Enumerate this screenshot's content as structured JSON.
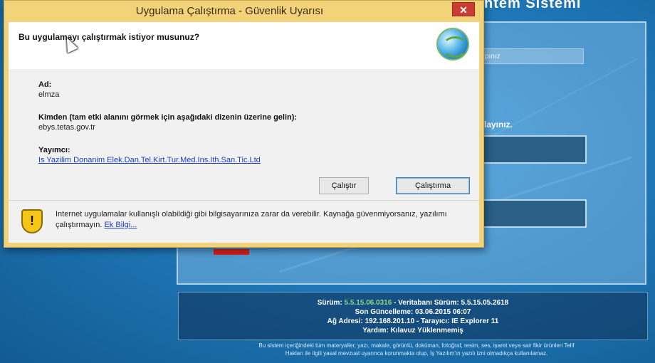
{
  "background": {
    "app_title": "ntem Sistemi",
    "login_hint": "pınız",
    "login_instruction": "layınız.",
    "info_line1_label": "Sürüm: ",
    "info_line1_version": "5.5.15.06.0316",
    "info_line1_rest": " - Veritabanı Sürüm: 5.5.15.05.2618",
    "info_line2": "Son Güncelleme: 03.06.2015 06:07",
    "info_line3": "Ağ Adresi: 192.168.201.10 - Tarayıcı: IE Explorer 11",
    "info_line4": "Yardım: Kılavuz Yüklenmemiş",
    "footer_line1": "Bu sistem içeriğindeki tüm materyaller, yazı, makale, görüntü, doküman, fotoğraf, resim, ses, işaret veya sair fikir ürünleri Telif",
    "footer_line2": "Hakları ile ilgili yasal mevzuat uyarınca korunmakta olup, İş Yazılım'ın yazılı izni olmadıkça kullanılamaz."
  },
  "dialog": {
    "title": "Uygulama Çalıştırma - Güvenlik Uyarısı",
    "close_glyph": "✕",
    "question": "Bu uygulamayı çalıştırmak istiyor musunuz?",
    "name_label": "Ad:",
    "name_value": "elmza",
    "from_label": "Kimden (tam etki alanını görmek için aşağıdaki dizenin üzerine gelin):",
    "from_value": "ebys.tetas.gov.tr",
    "publisher_label": "Yayımcı:",
    "publisher_value": "Is Yazilim Donanim Elek.Dan.Tel.Kirt.Tur.Med.Ins.Ith.San.Tic.Ltd",
    "run_button": "Çalıştır",
    "dont_run_button": "Çalıştırma",
    "warning_text": "Internet uygulamalar kullanışlı olabildiği gibi bilgisayarınıza zarar da verebilir. Kaynağa güvenmiyorsanız, yazılımı çalıştırmayın.",
    "more_info_link": "Ek Bilgi...",
    "shield_glyph": "!"
  },
  "icons": {
    "globe": "globe-icon",
    "shield": "shield-warning-icon",
    "cursor": "cursor-icon"
  },
  "colors": {
    "dialog_frame": "#f3d37a",
    "close_button": "#c93b33",
    "link": "#1a3fc4",
    "background": "#1f78b8"
  }
}
